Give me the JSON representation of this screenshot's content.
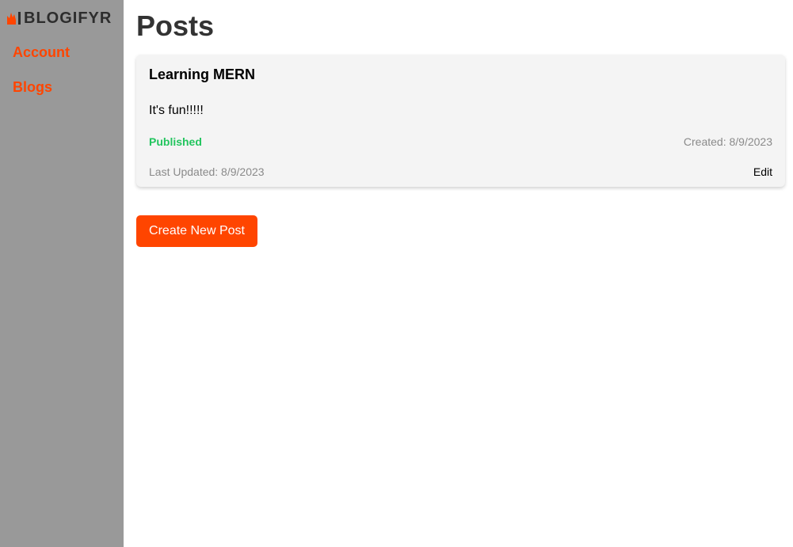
{
  "brand": {
    "name": "BLOGIFYR",
    "logo_icon": "flame-icon",
    "accent_color": "#ff4500"
  },
  "sidebar": {
    "items": [
      {
        "label": "Account"
      },
      {
        "label": "Blogs"
      }
    ]
  },
  "page": {
    "title": "Posts"
  },
  "posts": [
    {
      "title": "Learning MERN",
      "body": "It's fun!!!!!",
      "status": "Published",
      "status_color": "#22c55e",
      "created": "Created: 8/9/2023",
      "updated": "Last Updated: 8/9/2023",
      "edit_label": "Edit"
    }
  ],
  "actions": {
    "create_label": "Create New Post"
  }
}
